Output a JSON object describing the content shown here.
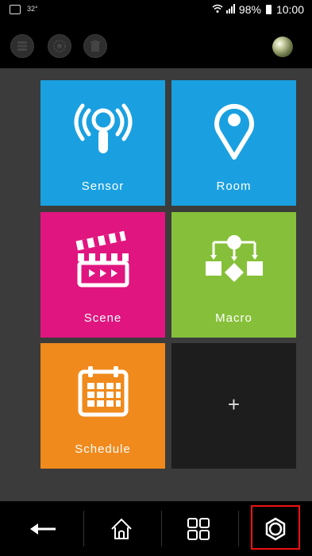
{
  "status_bar": {
    "temperature": "32°",
    "battery": "98%",
    "time": "10:00"
  },
  "toolbar": {
    "buttons": [
      "server-icon",
      "dial-icon",
      "trash-icon"
    ],
    "status_orb": "status-orb-icon"
  },
  "tiles": [
    {
      "label": "Sensor",
      "color": "#1aa0e0",
      "icon": "sensor-icon"
    },
    {
      "label": "Room",
      "color": "#1aa0e0",
      "icon": "location-pin-icon"
    },
    {
      "label": "Scene",
      "color": "#e0157f",
      "icon": "clapperboard-icon"
    },
    {
      "label": "Macro",
      "color": "#86c03a",
      "icon": "flowchart-icon"
    },
    {
      "label": "Schedule",
      "color": "#f08a1c",
      "icon": "calendar-icon"
    },
    {
      "label": "+",
      "color": "#1d1d1d",
      "icon": "plus-icon"
    }
  ],
  "navbar": {
    "items": [
      "back-arrow-icon",
      "home-icon",
      "grid-icon",
      "settings-gear-icon"
    ],
    "highlight_color": "#e11"
  }
}
